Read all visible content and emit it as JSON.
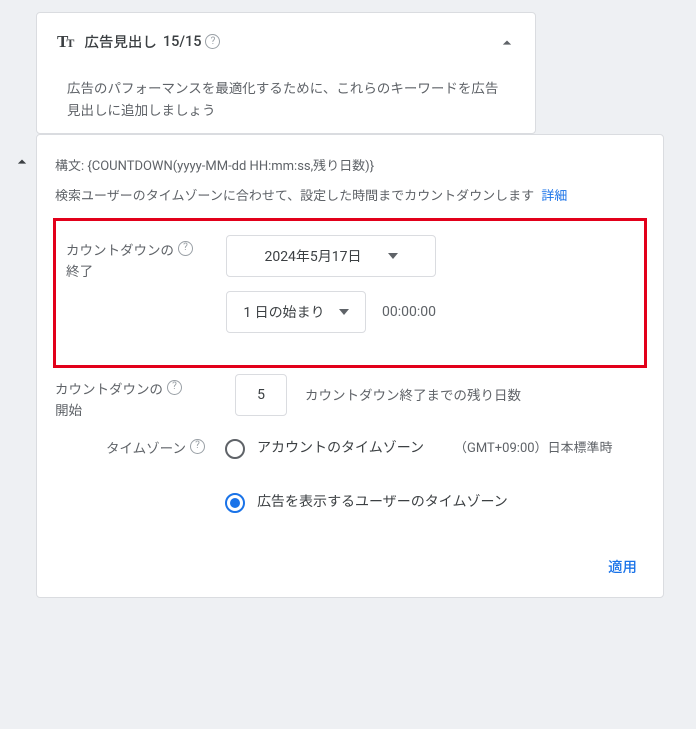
{
  "header": {
    "title": "広告見出し",
    "count": "15/15"
  },
  "description": "広告のパフォーマンスを最適化するために、これらのキーワードを広告見出しに追加しましょう",
  "panel": {
    "syntax": "構文: {COUNTDOWN(yyyy-MM-dd HH:mm:ss,残り日数)}",
    "explainer": "検索ユーザーのタイムゾーンに合わせて、設定した時間までカウントダウンします",
    "details_link": "詳細",
    "end_label_a": "カウントダウンの",
    "end_label_b": "終了",
    "date_value": "2024年5月17日",
    "day_start_value": "1 日の始まり",
    "time_value": "00:00:00",
    "start_label_a": "カウントダウンの",
    "start_label_b": "開始",
    "start_days": "5",
    "start_hint": "カウントダウン終了までの残り日数",
    "timezone_label": "タイムゾーン",
    "radio_account": "アカウントのタイムゾーン",
    "radio_account_extra": "（GMT+09:00）日本標準時",
    "radio_user": "広告を表示するユーザーのタイムゾーン",
    "apply": "適用"
  }
}
